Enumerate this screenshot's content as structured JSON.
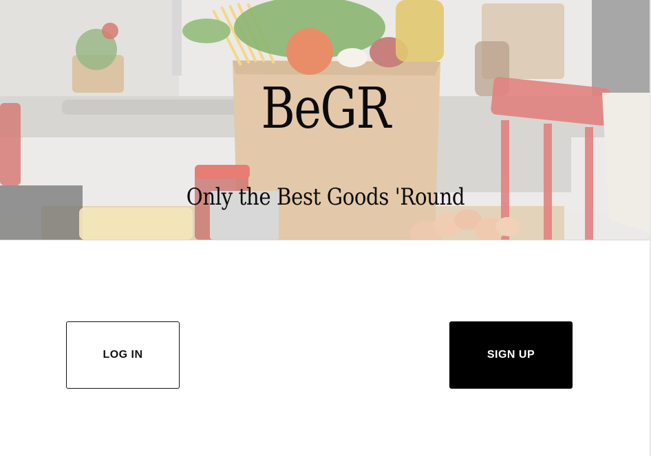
{
  "hero": {
    "brand": "BeGR",
    "tagline": "Only the Best Goods 'Round",
    "image_alt": "grocery bag with vegetables on kitchen counter"
  },
  "auth": {
    "login_label": "LOG IN",
    "signup_label": "SIGN UP"
  },
  "colors": {
    "login_bg": "#ffffff",
    "signup_bg": "#000000",
    "text_dark": "#0c0c0c"
  }
}
